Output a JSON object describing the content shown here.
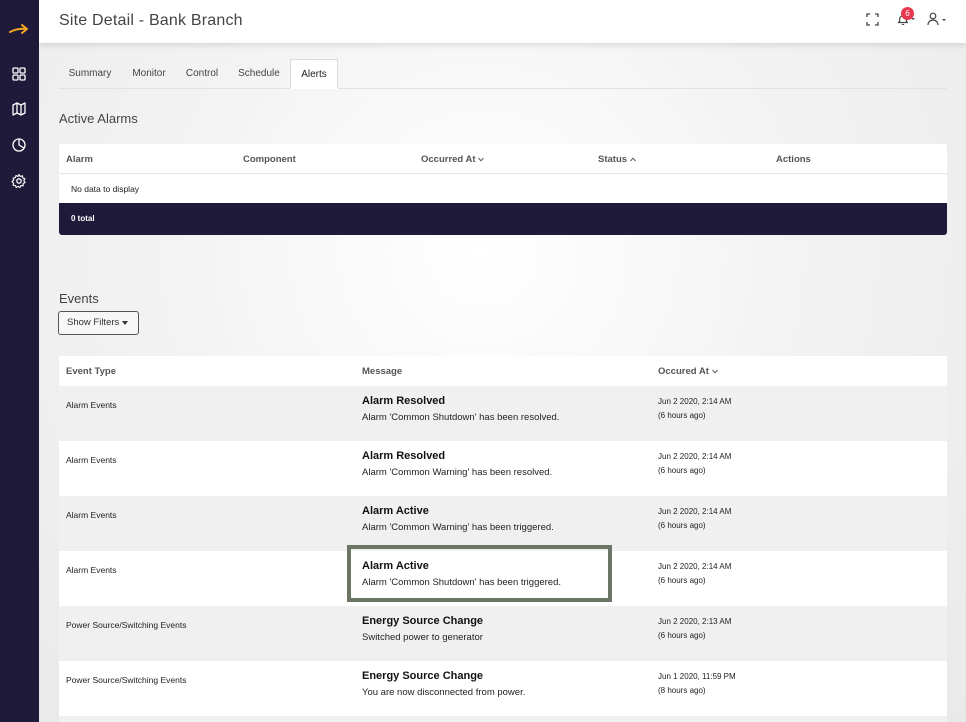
{
  "header": {
    "title": "Site Detail - Bank Branch",
    "notification_count": "6"
  },
  "sidebar": {
    "icons": [
      "dashboard-icon",
      "map-icon",
      "reports-icon",
      "settings-icon"
    ]
  },
  "tabs": [
    {
      "label": "Summary"
    },
    {
      "label": "Monitor"
    },
    {
      "label": "Control"
    },
    {
      "label": "Schedule"
    },
    {
      "label": "Alerts",
      "active": true
    }
  ],
  "active_alarms": {
    "title": "Active Alarms",
    "columns": [
      "Alarm",
      "Component",
      "Occurred At",
      "Status",
      "Actions"
    ],
    "empty_text": "No data to display",
    "total_text": "0 total"
  },
  "events": {
    "title": "Events",
    "filter_label": "Show Filters",
    "columns": [
      "Event Type",
      "Message",
      "Occured At"
    ],
    "rows": [
      {
        "type": "Alarm Events",
        "title": "Alarm Resolved",
        "message": "Alarm 'Common Shutdown' has been resolved.",
        "date": "Jun 2 2020, 2:14 AM",
        "ago": "(6 hours ago)"
      },
      {
        "type": "Alarm Events",
        "title": "Alarm Resolved",
        "message": "Alarm 'Common Warning' has been resolved.",
        "date": "Jun 2 2020, 2:14 AM",
        "ago": "(6 hours ago)"
      },
      {
        "type": "Alarm Events",
        "title": "Alarm Active",
        "message": "Alarm 'Common Warning' has been triggered.",
        "date": "Jun 2 2020, 2:14 AM",
        "ago": "(6 hours ago)"
      },
      {
        "type": "Alarm Events",
        "title": "Alarm Active",
        "message": "Alarm 'Common Shutdown' has been triggered.",
        "date": "Jun 2 2020, 2:14 AM",
        "ago": "(6 hours ago)"
      },
      {
        "type": "Power Source/Switching Events",
        "title": "Energy Source Change",
        "message": "Switched power to generator",
        "date": "Jun 2 2020, 2:13 AM",
        "ago": "(6 hours ago)"
      },
      {
        "type": "Power Source/Switching Events",
        "title": "Energy Source Change",
        "message": "You are now disconnected from power.",
        "date": "Jun 1 2020, 11:59 PM",
        "ago": "(8 hours ago)"
      }
    ]
  },
  "colors": {
    "sidebar": "#1f1a3a",
    "accent": "#f5a623",
    "badge": "#e8384f"
  }
}
